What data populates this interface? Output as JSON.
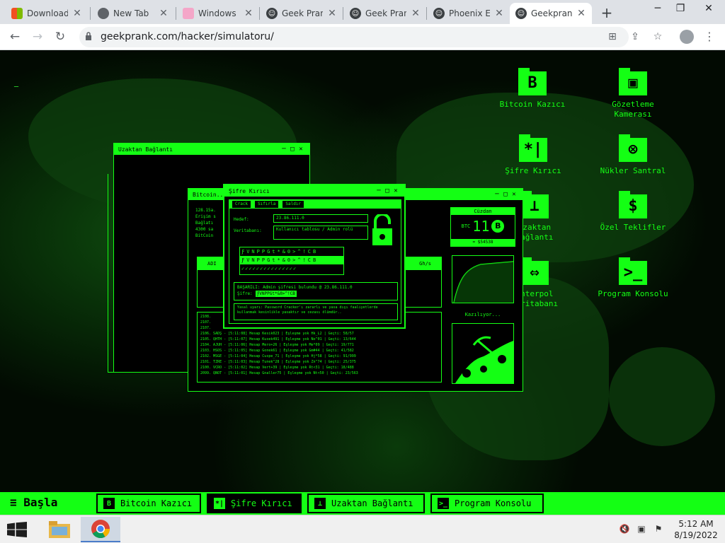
{
  "browser": {
    "tabs": [
      {
        "label": "Download",
        "icon": "windows-logo-icon"
      },
      {
        "label": "New Tab",
        "icon": "chrome-icon"
      },
      {
        "label": "Windows",
        "icon": "page-icon"
      },
      {
        "label": "Geek Pran",
        "icon": "geekprank-icon"
      },
      {
        "label": "Geek Pran",
        "icon": "geekprank-icon"
      },
      {
        "label": "Phoenix E",
        "icon": "geekprank-icon"
      },
      {
        "label": "Geekprank",
        "icon": "geekprank-icon"
      }
    ],
    "url": "geekprank.com/hacker/simulatoru/"
  },
  "desktop_icons": [
    {
      "label": "Bitcoin Kazıcı",
      "glyph": "B"
    },
    {
      "label": "Gözetleme Kamerası",
      "glyph": "▣"
    },
    {
      "label": "Şifre Kırıcı",
      "glyph": "*|"
    },
    {
      "label": "Nükler Santral",
      "glyph": "⊗"
    },
    {
      "label": "Uzaktan Bağlantı",
      "glyph": "⊥"
    },
    {
      "label": "Özel Teklifler",
      "glyph": "$"
    },
    {
      "label": "İnterpol Veritabanı",
      "glyph": "⇔"
    },
    {
      "label": "Program Konsolu",
      "glyph": ">_"
    }
  ],
  "windows": {
    "remote": {
      "title": "Uzaktan Bağlantı"
    },
    "bitcoin": {
      "title": "Bitcoin...",
      "lines": [
        "128.15a.",
        "Erişim s",
        "Bağlatı",
        "4300 sa",
        "BitCoin"
      ],
      "balance_label": "Cüzdan",
      "balance_value": "11",
      "balance_unit": "BTC",
      "balance_sub": "= $54538",
      "mining_label": "Kazılıyor...",
      "table_headers": [
        "ADI",
        "",
        "Gh/s"
      ],
      "log_lines": [
        "2108.",
        "2107.",
        "2107.",
        "2106. SADŞ - [5:11:08] Hesap Kesik023 | Eşleşme yok Hk_L2 | Geçti: 58/57",
        "2105. QHTH - [5:11:07] Hesap Kusek491 | Eşleşme yok No^01 | Geçti: 13/644",
        "2104. AJUH - [5:11:06] Hesap Mero+26 | Eşleşme yok Me*09 | Geçti: 19/771",
        "2103. HSOS - [5:11:05] Hesap Gonek61 | Eşleşme yok Gm#44 | Geçti: 41/582",
        "2102. MSGE - [5:11:04] Hesap Cuspe_71 | Eşleşme yok Hj*58 | Geçti: 91/999",
        "2101. TZRE - [5:11:03] Hesap Tunek^28 | Eşleşme yok Zn^74 | Geçti: 25/375",
        "2100. VCRO - [5:11:02] Hesap Vert+39 | Eşleşme yok Rt<31 | Geçti: 18/488",
        "2099. QNOT - [5:11:01] Hesap Gnaller75 | Eşleşme yok Nt<50 | Geçti: 23/563"
      ]
    },
    "cracker": {
      "title": "Şifre Kırıcı",
      "buttons": [
        "Crack",
        "Sıfırla",
        "Saldır"
      ],
      "target_label": "Hedef:",
      "target_value": "23.86.111.0",
      "db_label": "Veritabanı:",
      "db_value": "Kullanıcı tablosu / Admin rolü",
      "grid_row1": "ƑVNPPGt*&0>^!CB",
      "grid_row2": "ƑVNPPGt*&0>^!CB",
      "success": "BAŞARILI: Admin şifresi bulundu @ 23.86.111.0",
      "password_label": "Şifre:",
      "password_value": "ƑVNPPGt*&0>^!CB",
      "warning": "Yasal uyarı: Password Cracker'ı zararlı ve yasa dışı faaliyetlerde kullanmak kesinlikle yasaktır ve cezası ölümdür.."
    }
  },
  "taskbar_green": {
    "start_label": "Başla",
    "items": [
      {
        "label": "Bitcoin Kazıcı",
        "glyph": "B",
        "active": false
      },
      {
        "label": "Şifre Kırıcı",
        "glyph": "*|",
        "active": true
      },
      {
        "label": "Uzaktan Bağlantı",
        "glyph": "⊥",
        "active": false
      },
      {
        "label": "Program Konsolu",
        "glyph": ">_",
        "active": false
      }
    ]
  },
  "system": {
    "time": "5:12 AM",
    "date": "8/19/2022"
  },
  "colors": {
    "accent": "#14ff14",
    "bg": "#020a02"
  }
}
